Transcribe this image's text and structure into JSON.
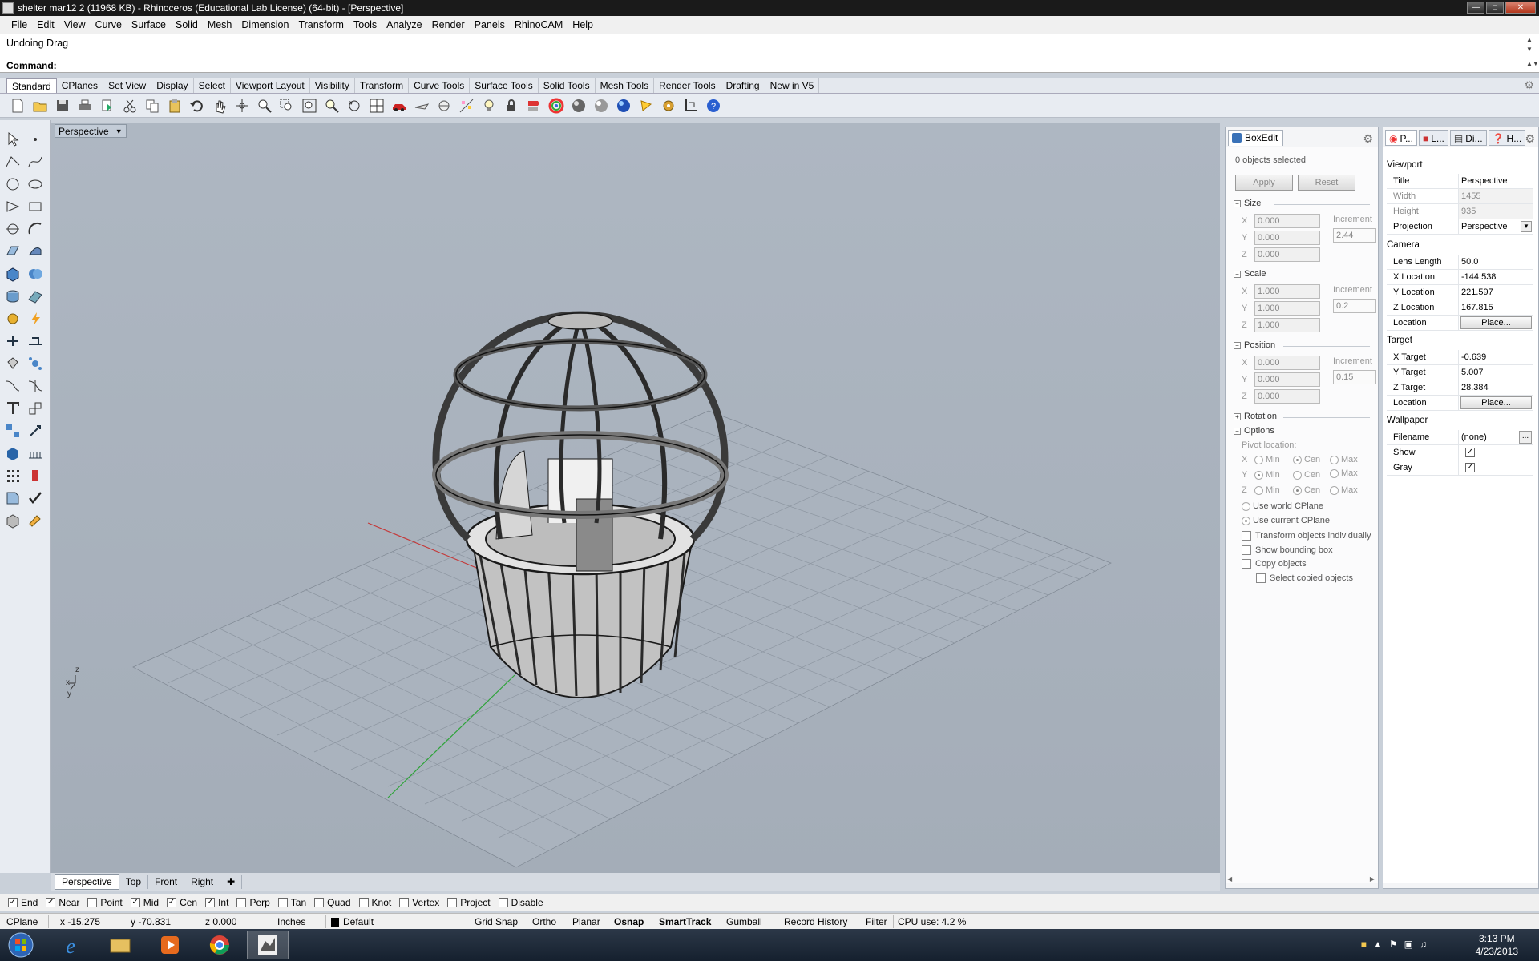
{
  "window": {
    "title": "shelter mar12 2 (11968 KB) - Rhinoceros (Educational Lab License) (64-bit) - [Perspective]"
  },
  "menu": [
    "File",
    "Edit",
    "View",
    "Curve",
    "Surface",
    "Solid",
    "Mesh",
    "Dimension",
    "Transform",
    "Tools",
    "Analyze",
    "Render",
    "Panels",
    "RhinoCAM",
    "Help"
  ],
  "command": {
    "history": "Undoing Drag",
    "prompt": "Command:"
  },
  "toolbar_tabs": [
    "Standard",
    "CPlanes",
    "Set View",
    "Display",
    "Select",
    "Viewport Layout",
    "Visibility",
    "Transform",
    "Curve Tools",
    "Surface Tools",
    "Solid Tools",
    "Mesh Tools",
    "Render Tools",
    "Drafting",
    "New in V5"
  ],
  "toolbar_icons": [
    "new-icon",
    "open-icon",
    "save-icon",
    "print-icon",
    "import-icon",
    "cut-icon",
    "copy-icon",
    "paste-icon",
    "undo-icon",
    "pan-icon",
    "rotate-view-icon",
    "zoom-icon",
    "zoom-window-icon",
    "zoom-extents-icon",
    "zoom-selected-icon",
    "undo-view-icon",
    "four-viewports-icon",
    "car-icon",
    "plane-icon",
    "cplane-icon",
    "select-points-icon",
    "light-bulb-icon",
    "lock-icon",
    "properties-icon",
    "color-wheel-icon",
    "shade-icon",
    "render-icon",
    "render-sphere-icon",
    "sun-icon",
    "gear-options-icon",
    "grid-snap-icon",
    "help-icon"
  ],
  "viewport": {
    "title": "Perspective"
  },
  "view_tabs": [
    "Perspective",
    "Top",
    "Front",
    "Right"
  ],
  "osnap": [
    {
      "label": "End",
      "checked": true
    },
    {
      "label": "Near",
      "checked": true
    },
    {
      "label": "Point",
      "checked": false
    },
    {
      "label": "Mid",
      "checked": true
    },
    {
      "label": "Cen",
      "checked": true
    },
    {
      "label": "Int",
      "checked": true
    },
    {
      "label": "Perp",
      "checked": false
    },
    {
      "label": "Tan",
      "checked": false
    },
    {
      "label": "Quad",
      "checked": false
    },
    {
      "label": "Knot",
      "checked": false
    },
    {
      "label": "Vertex",
      "checked": false
    },
    {
      "label": "Project",
      "checked": false
    },
    {
      "label": "Disable",
      "checked": false
    }
  ],
  "status": {
    "cplane": "CPlane",
    "x": "x -15.275",
    "y": "y -70.831",
    "z": "z 0.000",
    "units": "Inches",
    "layer": "Default",
    "toggles": [
      "Grid Snap",
      "Ortho",
      "Planar",
      "Osnap",
      "SmartTrack",
      "Gumball",
      "Record History",
      "Filter"
    ],
    "cpu": "CPU use: 4.2 %"
  },
  "taskbar": {
    "time": "3:13 PM",
    "date": "4/23/2013"
  },
  "boxedit": {
    "tab": "BoxEdit",
    "selected": "0 objects selected",
    "apply": "Apply",
    "reset": "Reset",
    "size": {
      "title": "Size",
      "x": "0.000",
      "y": "0.000",
      "z": "0.000",
      "inc_label": "Increment",
      "inc": "2.44"
    },
    "scale": {
      "title": "Scale",
      "x": "1.000",
      "y": "1.000",
      "z": "1.000",
      "inc_label": "Increment",
      "inc": "0.2"
    },
    "position": {
      "title": "Position",
      "x": "0.000",
      "y": "0.000",
      "z": "0.000",
      "inc_label": "Increment",
      "inc": "0.15"
    },
    "rotation": "Rotation",
    "options": "Options",
    "pivot": "Pivot location:",
    "min": "Min",
    "cen": "Cen",
    "max": "Max",
    "world": "Use world CPlane",
    "current": "Use current CPlane",
    "transform": "Transform objects individually",
    "bbox": "Show bounding box",
    "copy": "Copy objects",
    "selcopied": "Select copied objects",
    "axis_x": "X",
    "axis_y": "Y",
    "axis_z": "Z"
  },
  "props": {
    "tabs": [
      "P...",
      "L...",
      "Di...",
      "H..."
    ],
    "viewport": "Viewport",
    "title_k": "Title",
    "title_v": "Perspective",
    "width_k": "Width",
    "width_v": "1455",
    "height_k": "Height",
    "height_v": "935",
    "proj_k": "Projection",
    "proj_v": "Perspective",
    "camera": "Camera",
    "lens_k": "Lens Length",
    "lens_v": "50.0",
    "xloc_k": "X Location",
    "xloc_v": "-144.538",
    "yloc_k": "Y Location",
    "yloc_v": "221.597",
    "zloc_k": "Z Location",
    "zloc_v": "167.815",
    "loc_k": "Location",
    "place": "Place...",
    "target": "Target",
    "xt_k": "X Target",
    "xt_v": "-0.639",
    "yt_k": "Y Target",
    "yt_v": "5.007",
    "zt_k": "Z Target",
    "zt_v": "28.384",
    "wallpaper": "Wallpaper",
    "file_k": "Filename",
    "file_v": "(none)",
    "show_k": "Show",
    "gray_k": "Gray"
  }
}
